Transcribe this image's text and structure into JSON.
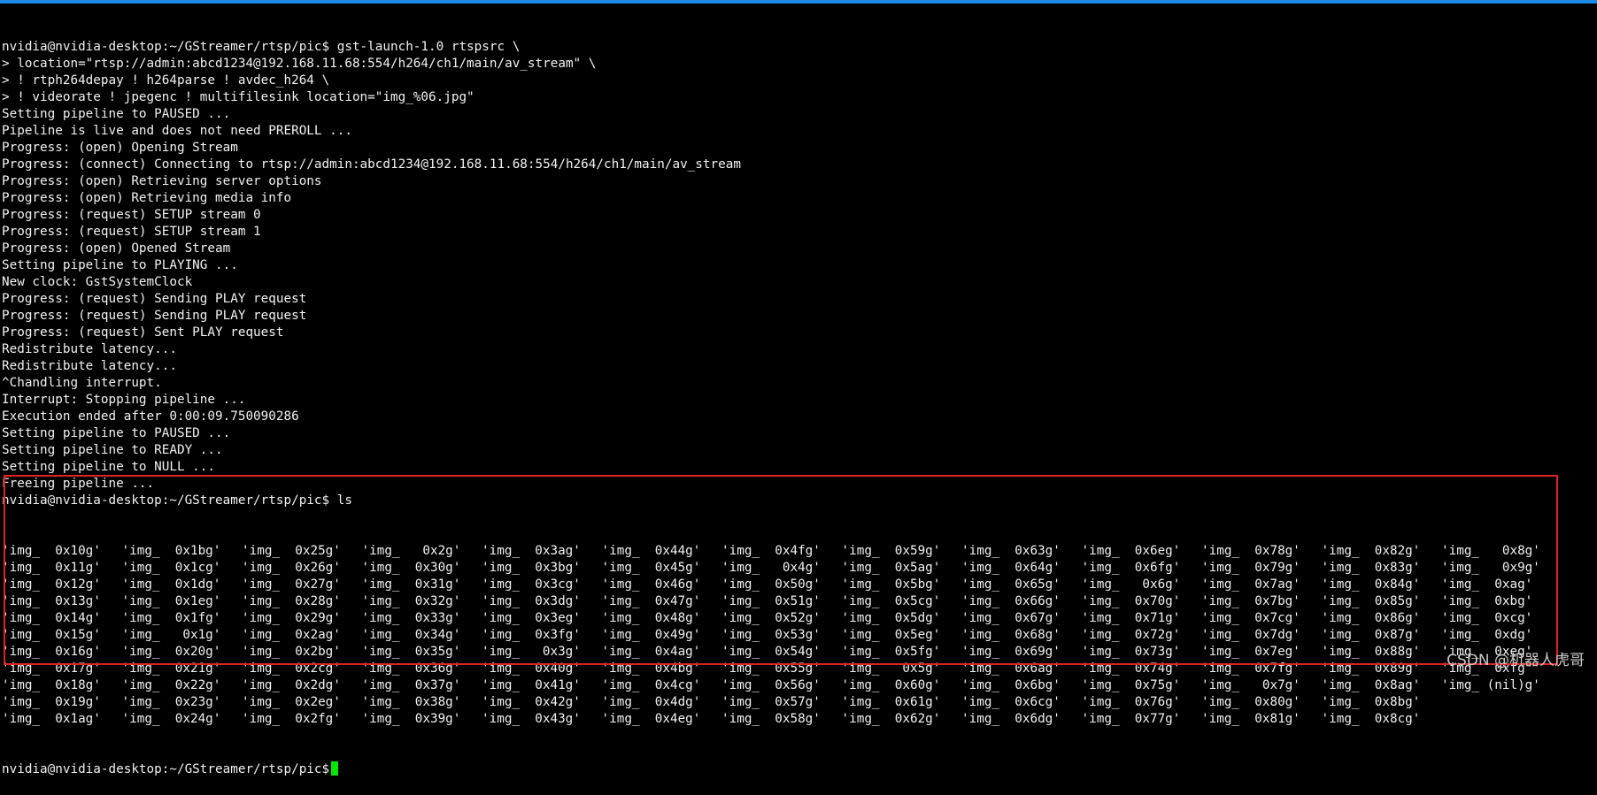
{
  "colors": {
    "background": "#000000",
    "text": "#f2f2f2",
    "top_bar": "#1e88e5",
    "highlight_box": "#e02424",
    "cursor": "#00e600",
    "watermark": "#c8c8c8"
  },
  "terminal": {
    "lines": [
      "nvidia@nvidia-desktop:~/GStreamer/rtsp/pic$ gst-launch-1.0 rtspsrc \\",
      "> location=\"rtsp://admin:abcd1234@192.168.11.68:554/h264/ch1/main/av_stream\" \\",
      "> ! rtph264depay ! h264parse ! avdec_h264 \\",
      "> ! videorate ! jpegenc ! multifilesink location=\"img_%06.jpg\"",
      "Setting pipeline to PAUSED ...",
      "Pipeline is live and does not need PREROLL ...",
      "Progress: (open) Opening Stream",
      "Progress: (connect) Connecting to rtsp://admin:abcd1234@192.168.11.68:554/h264/ch1/main/av_stream",
      "Progress: (open) Retrieving server options",
      "Progress: (open) Retrieving media info",
      "Progress: (request) SETUP stream 0",
      "Progress: (request) SETUP stream 1",
      "Progress: (open) Opened Stream",
      "Setting pipeline to PLAYING ...",
      "New clock: GstSystemClock",
      "Progress: (request) Sending PLAY request",
      "Progress: (request) Sending PLAY request",
      "Progress: (request) Sent PLAY request",
      "Redistribute latency...",
      "Redistribute latency...",
      "^Chandling interrupt.",
      "Interrupt: Stopping pipeline ...",
      "Execution ended after 0:00:09.750090286",
      "Setting pipeline to PAUSED ...",
      "Setting pipeline to READY ...",
      "Setting pipeline to NULL ...",
      "Freeing pipeline ...",
      "nvidia@nvidia-desktop:~/GStreamer/rtsp/pic$ ls"
    ],
    "ls_rows": [
      [
        "'img_  0x10g'",
        "'img_  0x1bg'",
        "'img_  0x25g'",
        "'img_   0x2g'",
        "'img_  0x3ag'",
        "'img_  0x44g'",
        "'img_  0x4fg'",
        "'img_  0x59g'",
        "'img_  0x63g'",
        "'img_  0x6eg'",
        "'img_  0x78g'",
        "'img_  0x82g'",
        "'img_   0x8g'"
      ],
      [
        "'img_  0x11g'",
        "'img_  0x1cg'",
        "'img_  0x26g'",
        "'img_  0x30g'",
        "'img_  0x3bg'",
        "'img_  0x45g'",
        "'img_   0x4g'",
        "'img_  0x5ag'",
        "'img_  0x64g'",
        "'img_  0x6fg'",
        "'img_  0x79g'",
        "'img_  0x83g'",
        "'img_   0x9g'"
      ],
      [
        "'img_  0x12g'",
        "'img_  0x1dg'",
        "'img_  0x27g'",
        "'img_  0x31g'",
        "'img_  0x3cg'",
        "'img_  0x46g'",
        "'img_  0x50g'",
        "'img_  0x5bg'",
        "'img_  0x65g'",
        "'img_   0x6g'",
        "'img_  0x7ag'",
        "'img_  0x84g'",
        "'img_  0xag'"
      ],
      [
        "'img_  0x13g'",
        "'img_  0x1eg'",
        "'img_  0x28g'",
        "'img_  0x32g'",
        "'img_  0x3dg'",
        "'img_  0x47g'",
        "'img_  0x51g'",
        "'img_  0x5cg'",
        "'img_  0x66g'",
        "'img_  0x70g'",
        "'img_  0x7bg'",
        "'img_  0x85g'",
        "'img_  0xbg'"
      ],
      [
        "'img_  0x14g'",
        "'img_  0x1fg'",
        "'img_  0x29g'",
        "'img_  0x33g'",
        "'img_  0x3eg'",
        "'img_  0x48g'",
        "'img_  0x52g'",
        "'img_  0x5dg'",
        "'img_  0x67g'",
        "'img_  0x71g'",
        "'img_  0x7cg'",
        "'img_  0x86g'",
        "'img_  0xcg'"
      ],
      [
        "'img_  0x15g'",
        "'img_   0x1g'",
        "'img_  0x2ag'",
        "'img_  0x34g'",
        "'img_  0x3fg'",
        "'img_  0x49g'",
        "'img_  0x53g'",
        "'img_  0x5eg'",
        "'img_  0x68g'",
        "'img_  0x72g'",
        "'img_  0x7dg'",
        "'img_  0x87g'",
        "'img_  0xdg'"
      ],
      [
        "'img_  0x16g'",
        "'img_  0x20g'",
        "'img_  0x2bg'",
        "'img_  0x35g'",
        "'img_   0x3g'",
        "'img_  0x4ag'",
        "'img_  0x54g'",
        "'img_  0x5fg'",
        "'img_  0x69g'",
        "'img_  0x73g'",
        "'img_  0x7eg'",
        "'img_  0x88g'",
        "'img_  0xeg'"
      ],
      [
        "'img_  0x17g'",
        "'img_  0x21g'",
        "'img_  0x2cg'",
        "'img_  0x36g'",
        "'img_  0x40g'",
        "'img_  0x4bg'",
        "'img_  0x55g'",
        "'img_   0x5g'",
        "'img_  0x6ag'",
        "'img_  0x74g'",
        "'img_  0x7fg'",
        "'img_  0x89g'",
        "'img_  0xfg'"
      ],
      [
        "'img_  0x18g'",
        "'img_  0x22g'",
        "'img_  0x2dg'",
        "'img_  0x37g'",
        "'img_  0x41g'",
        "'img_  0x4cg'",
        "'img_  0x56g'",
        "'img_  0x60g'",
        "'img_  0x6bg'",
        "'img_  0x75g'",
        "'img_   0x7g'",
        "'img_  0x8ag'",
        "'img_ (nil)g'"
      ],
      [
        "'img_  0x19g'",
        "'img_  0x23g'",
        "'img_  0x2eg'",
        "'img_  0x38g'",
        "'img_  0x42g'",
        "'img_  0x4dg'",
        "'img_  0x57g'",
        "'img_  0x61g'",
        "'img_  0x6cg'",
        "'img_  0x76g'",
        "'img_  0x80g'",
        "'img_  0x8bg'"
      ],
      [
        "'img_  0x1ag'",
        "'img_  0x24g'",
        "'img_  0x2fg'",
        "'img_  0x39g'",
        "'img_  0x43g'",
        "'img_  0x4eg'",
        "'img_  0x58g'",
        "'img_  0x62g'",
        "'img_  0x6dg'",
        "'img_  0x77g'",
        "'img_  0x81g'",
        "'img_  0x8cg'"
      ]
    ],
    "final_prompt": "nvidia@nvidia-desktop:~/GStreamer/rtsp/pic$"
  },
  "watermark": "CSDN @机器人虎哥"
}
